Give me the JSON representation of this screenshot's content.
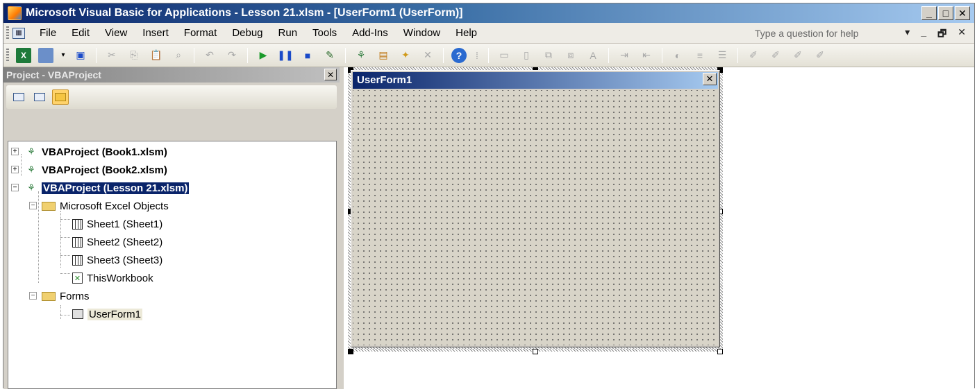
{
  "window": {
    "title": "Microsoft Visual Basic for Applications - Lesson 21.xlsm - [UserForm1 (UserForm)]",
    "minimize": "_",
    "restore": "□",
    "close": "✕"
  },
  "menu": {
    "items": [
      {
        "label": "File"
      },
      {
        "label": "Edit"
      },
      {
        "label": "View"
      },
      {
        "label": "Insert"
      },
      {
        "label": "Format"
      },
      {
        "label": "Debug"
      },
      {
        "label": "Run"
      },
      {
        "label": "Tools"
      },
      {
        "label": "Add-Ins"
      },
      {
        "label": "Window"
      },
      {
        "label": "Help"
      }
    ],
    "help_placeholder": "Type a question for help",
    "right_controls": [
      "▾",
      "_",
      "🗗",
      "✕"
    ]
  },
  "toolbar": {
    "icons": [
      "excel-icon",
      "insert-userform-icon",
      "save-icon",
      "cut-icon",
      "copy-icon",
      "paste-icon",
      "find-icon",
      "undo-icon",
      "redo-icon",
      "run-icon",
      "break-icon",
      "reset-icon",
      "design-mode-icon",
      "project-explorer-icon",
      "properties-icon",
      "object-browser-icon",
      "toolbox-icon",
      "help-icon"
    ]
  },
  "project": {
    "title": "Project - VBAProject",
    "close": "✕",
    "tree": {
      "book1": "VBAProject (Book1.xlsm)",
      "book2": "VBAProject (Book2.xlsm)",
      "lesson21": "VBAProject (Lesson 21.xlsm)",
      "excel_objects": "Microsoft Excel Objects",
      "sheet1": "Sheet1 (Sheet1)",
      "sheet2": "Sheet2 (Sheet2)",
      "sheet3": "Sheet3 (Sheet3)",
      "thisworkbook": "ThisWorkbook",
      "forms": "Forms",
      "userform1": "UserForm1"
    }
  },
  "userform": {
    "caption": "UserForm1",
    "close": "✕"
  },
  "colors": {
    "title_gradient_start": "#0a246a",
    "title_gradient_end": "#a6caf0",
    "face": "#d4d0c8",
    "selection": "#0a246a"
  }
}
